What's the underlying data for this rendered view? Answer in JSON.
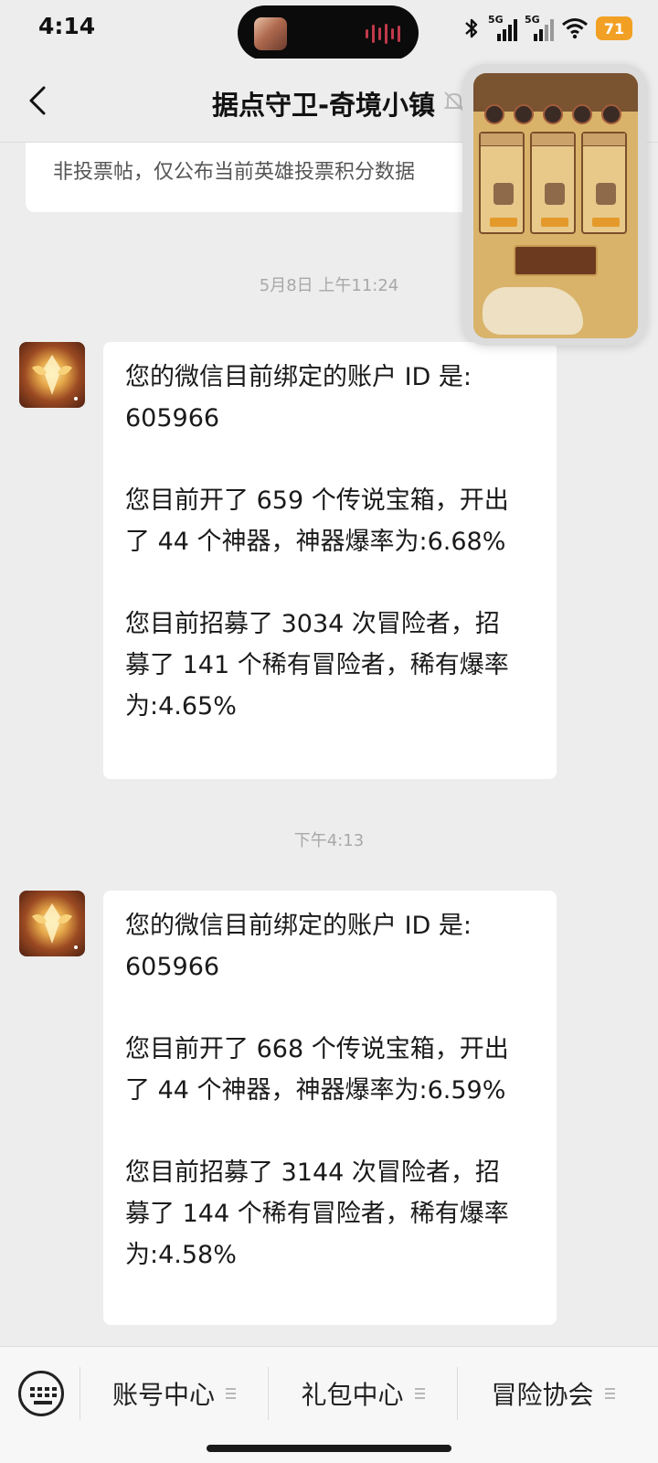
{
  "status_bar": {
    "time": "4:14",
    "signal_1_label": "5G",
    "signal_2_label": "5G",
    "battery": "71",
    "battery_color": "#f2a024"
  },
  "header": {
    "title": "据点守卫-奇境小镇",
    "icons": [
      "back-icon",
      "mute-bell-icon"
    ]
  },
  "previous_message": {
    "text": "非投票帖，仅公布当前英雄投票积分数据"
  },
  "messages": [
    {
      "timestamp": "5月8日 上午11:24",
      "paragraphs": [
        "您的微信目前绑定的账户 ID 是:\n605966",
        "您目前开了 659 个传说宝箱，开出\n了 44 个神器，神器爆率为:6.68%",
        "您目前招募了 3034 次冒险者，招\n募了 141 个稀有冒险者，稀有爆率\n为:4.65%"
      ]
    },
    {
      "timestamp": "下午4:13",
      "paragraphs": [
        "您的微信目前绑定的账户 ID 是:\n605966",
        "您目前开了 668 个传说宝箱，开出\n了 44 个神器，神器爆率为:6.59%",
        "您目前招募了 3144 次冒险者，招\n募了 144 个稀有冒险者，稀有爆率\n为:4.58%"
      ]
    }
  ],
  "bottom_menu": {
    "items": [
      "账号中心",
      "礼包中心",
      "冒险协会"
    ]
  },
  "colors": {
    "background": "#ededed",
    "bubble": "#ffffff",
    "timestamp": "#a8a8a8"
  }
}
